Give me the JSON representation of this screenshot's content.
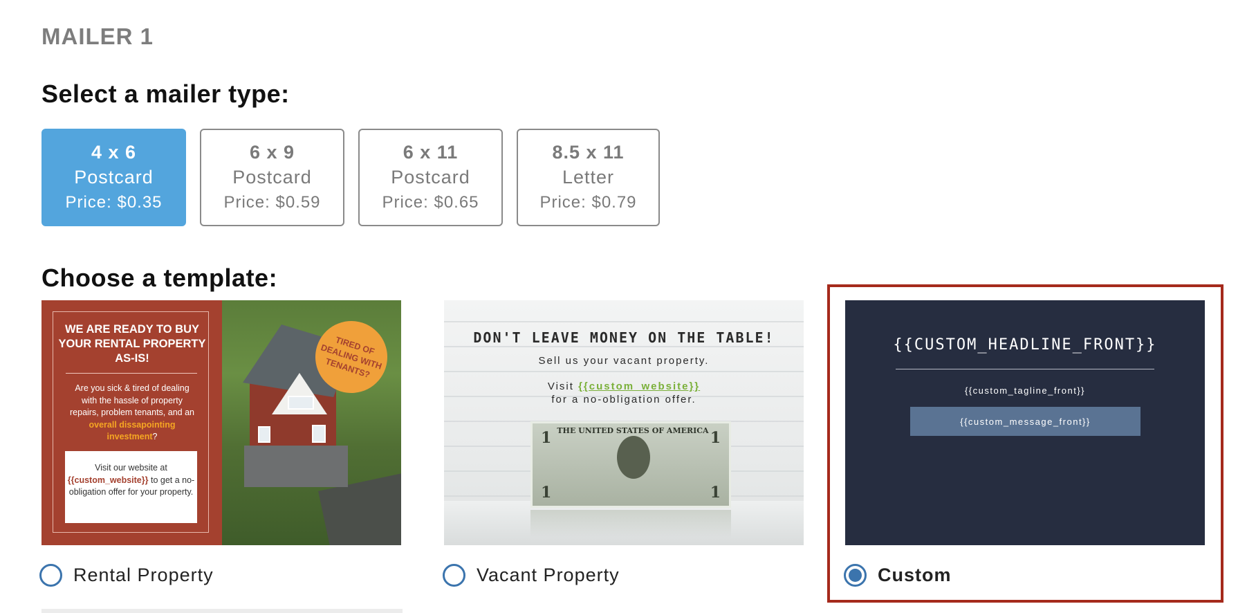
{
  "section_label": "MAILER 1",
  "mailer_heading": "Select a mailer type:",
  "template_heading": "Choose a template:",
  "mailer_types": [
    {
      "size": "4 x 6",
      "kind": "Postcard",
      "price": "Price: $0.35",
      "selected": true
    },
    {
      "size": "6 x 9",
      "kind": "Postcard",
      "price": "Price: $0.59",
      "selected": false
    },
    {
      "size": "6 x 11",
      "kind": "Postcard",
      "price": "Price: $0.65",
      "selected": false
    },
    {
      "size": "8.5 x 11",
      "kind": "Letter",
      "price": "Price: $0.79",
      "selected": false
    }
  ],
  "templates": {
    "rental": {
      "label": "Rental Property",
      "selected": false,
      "headline": "WE ARE READY TO BUY YOUR RENTAL PROPERTY AS-IS!",
      "body_before": "Are you sick & tired of dealing with the hassle of property repairs, problem tenants, and an",
      "body_highlight": "overall dissapointing investment",
      "body_after": "?",
      "box_line1": "Visit our website at",
      "box_link": "{{custom_website}}",
      "box_line2": "to get a no-obligation offer for your property.",
      "badge": "TIRED OF DEALING WITH TENANTS?"
    },
    "vacant": {
      "label": "Vacant Property",
      "selected": false,
      "headline": "DON'T LEAVE MONEY ON THE TABLE!",
      "subline": "Sell us your vacant property.",
      "visit": "Visit",
      "link": "{{custom_website}}",
      "offer": "for a no-obligation offer.",
      "bill_title": "THE UNITED STATES OF AMERICA",
      "bill_number": "1"
    },
    "custom": {
      "label": "Custom",
      "selected": true,
      "headline": "{{CUSTOM_HEADLINE_FRONT}}",
      "tagline": "{{custom_tagline_front}}",
      "message": "{{custom_message_front}}"
    }
  },
  "colors": {
    "selected_card": "#53a5dd",
    "radio": "#3b74ad",
    "highlight_border": "#a52a1c",
    "rental_red": "#a4412f",
    "custom_navy": "#262d40"
  }
}
